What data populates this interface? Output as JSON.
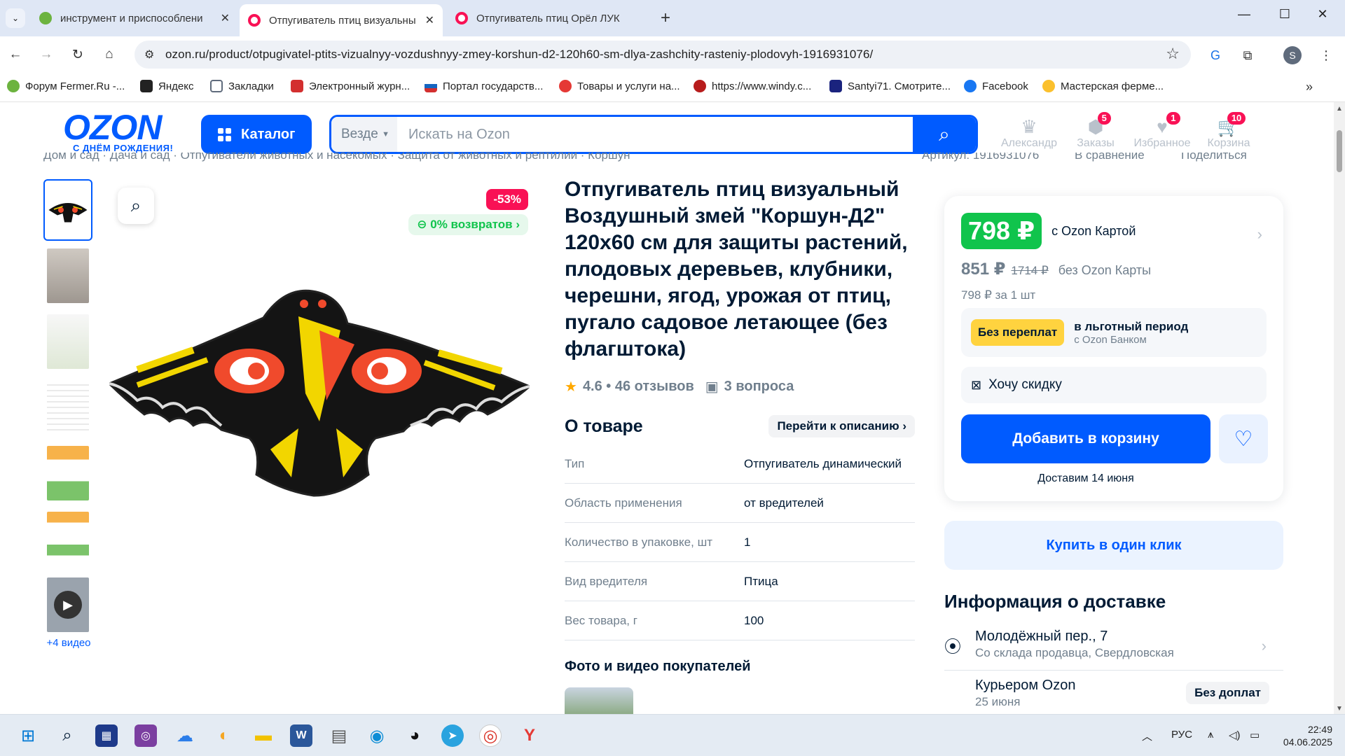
{
  "browser": {
    "tabs": [
      {
        "title": "инструмент и приспособлени",
        "active": false,
        "fav_color": "#6cb33f"
      },
      {
        "title": "Отпугиватель птиц визуальны",
        "active": true,
        "fav_color": "#f91155"
      },
      {
        "title": "Отпугиватель птиц Орёл ЛУК",
        "active": false,
        "fav_color": "#f91155"
      }
    ],
    "url": "ozon.ru/product/otpugivatel-ptits-vizualnyy-vozdushnyy-zmey-korshun-d2-120h60-sm-dlya-zashchity-rasteniy-plodovyh-1916931076/",
    "profile_letter": "S",
    "bookmarks": [
      {
        "label": "Форум Fermer.Ru -...",
        "color": "#6cb33f"
      },
      {
        "label": "Яндекс",
        "color": "#222222"
      },
      {
        "label": "Закладки",
        "color": "#5f6b7c"
      },
      {
        "label": "Электронный журн...",
        "color": "#d32f2f"
      },
      {
        "label": "Портал государств...",
        "color": "#1565c0"
      },
      {
        "label": "Товары и услуги на...",
        "color": "#e53935"
      },
      {
        "label": "https://www.windy.c...",
        "color": "#b71c1c"
      },
      {
        "label": "Santyi71. Смотрите...",
        "color": "#1a237e"
      },
      {
        "label": "Facebook",
        "color": "#1877f2"
      },
      {
        "label": "Мастерская ферме...",
        "color": "#fbc02d"
      }
    ]
  },
  "header": {
    "logo": "OZON",
    "logo_sub": "С ДНЁМ РОЖДЕНИЯ!",
    "catalog": "Каталог",
    "search_scope": "Везде",
    "search_placeholder": "Искать на Ozon",
    "user": "Александр",
    "orders": "Заказы",
    "orders_count": "5",
    "favorites": "Избранное",
    "favorites_count": "1",
    "cart": "Корзина",
    "cart_count": "10"
  },
  "breadcrumbs": "Дом и сад  ·  Дача и сад  ·  Отпугиватели животных и насекомых  ·  Защита от животных и рептилий  ·  Коршун",
  "crumb_actions": {
    "article": "Артикул: 1916931076",
    "compare": "В сравнение",
    "share": "Поделиться"
  },
  "gallery": {
    "discount": "-53%",
    "returns": "0% возвратов",
    "more_video": "+4 видео"
  },
  "product": {
    "title": "Отпугиватель птиц визуальный Воздушный змей \"Коршун-Д2\" 120х60 см для защиты растений, плодовых деревьев, клубники, черешни, ягод, урожая от птиц, пугало садовое летающее (без флагштока)",
    "rating": "4.6 • 46 отзывов",
    "questions": "3 вопроса",
    "about_title": "О товаре",
    "about_link": "Перейти к описанию",
    "props": [
      {
        "k": "Тип",
        "v": "Отпугиватель динамический"
      },
      {
        "k": "Область применения",
        "v": "от вредителей"
      },
      {
        "k": "Количество в упаковке, шт",
        "v": "1"
      },
      {
        "k": "Вид вредителя",
        "v": "Птица"
      },
      {
        "k": "Вес товара, г",
        "v": "100"
      }
    ],
    "photos_title": "Фото и видео покупателей"
  },
  "price": {
    "main": "798 ₽",
    "main_label": "с Ozon Картой",
    "old": "851 ₽",
    "strike": "1714 ₽",
    "old_label": "без Ozon Карты",
    "unit": "798 ₽ за 1 шт",
    "installment_badge": "Без переплат",
    "installment_t1": "в льготный период",
    "installment_t2": "с Ozon Банком",
    "want_discount": "Хочу скидку",
    "add_to_cart": "Добавить в корзину",
    "delivery": "Доставим 14 июня",
    "one_click": "Купить в один клик"
  },
  "delivery_info": {
    "title": "Информация о доставке",
    "addr": "Молодёжный пер., 7",
    "addr_sub": "Со склада продавца, Свердловская",
    "courier": "Курьером Ozon",
    "courier_date": "25 июня",
    "courier_tag": "Без доплат"
  },
  "taskbar": {
    "lang": "РУС",
    "time": "22:49",
    "date": "04.06.2025"
  }
}
